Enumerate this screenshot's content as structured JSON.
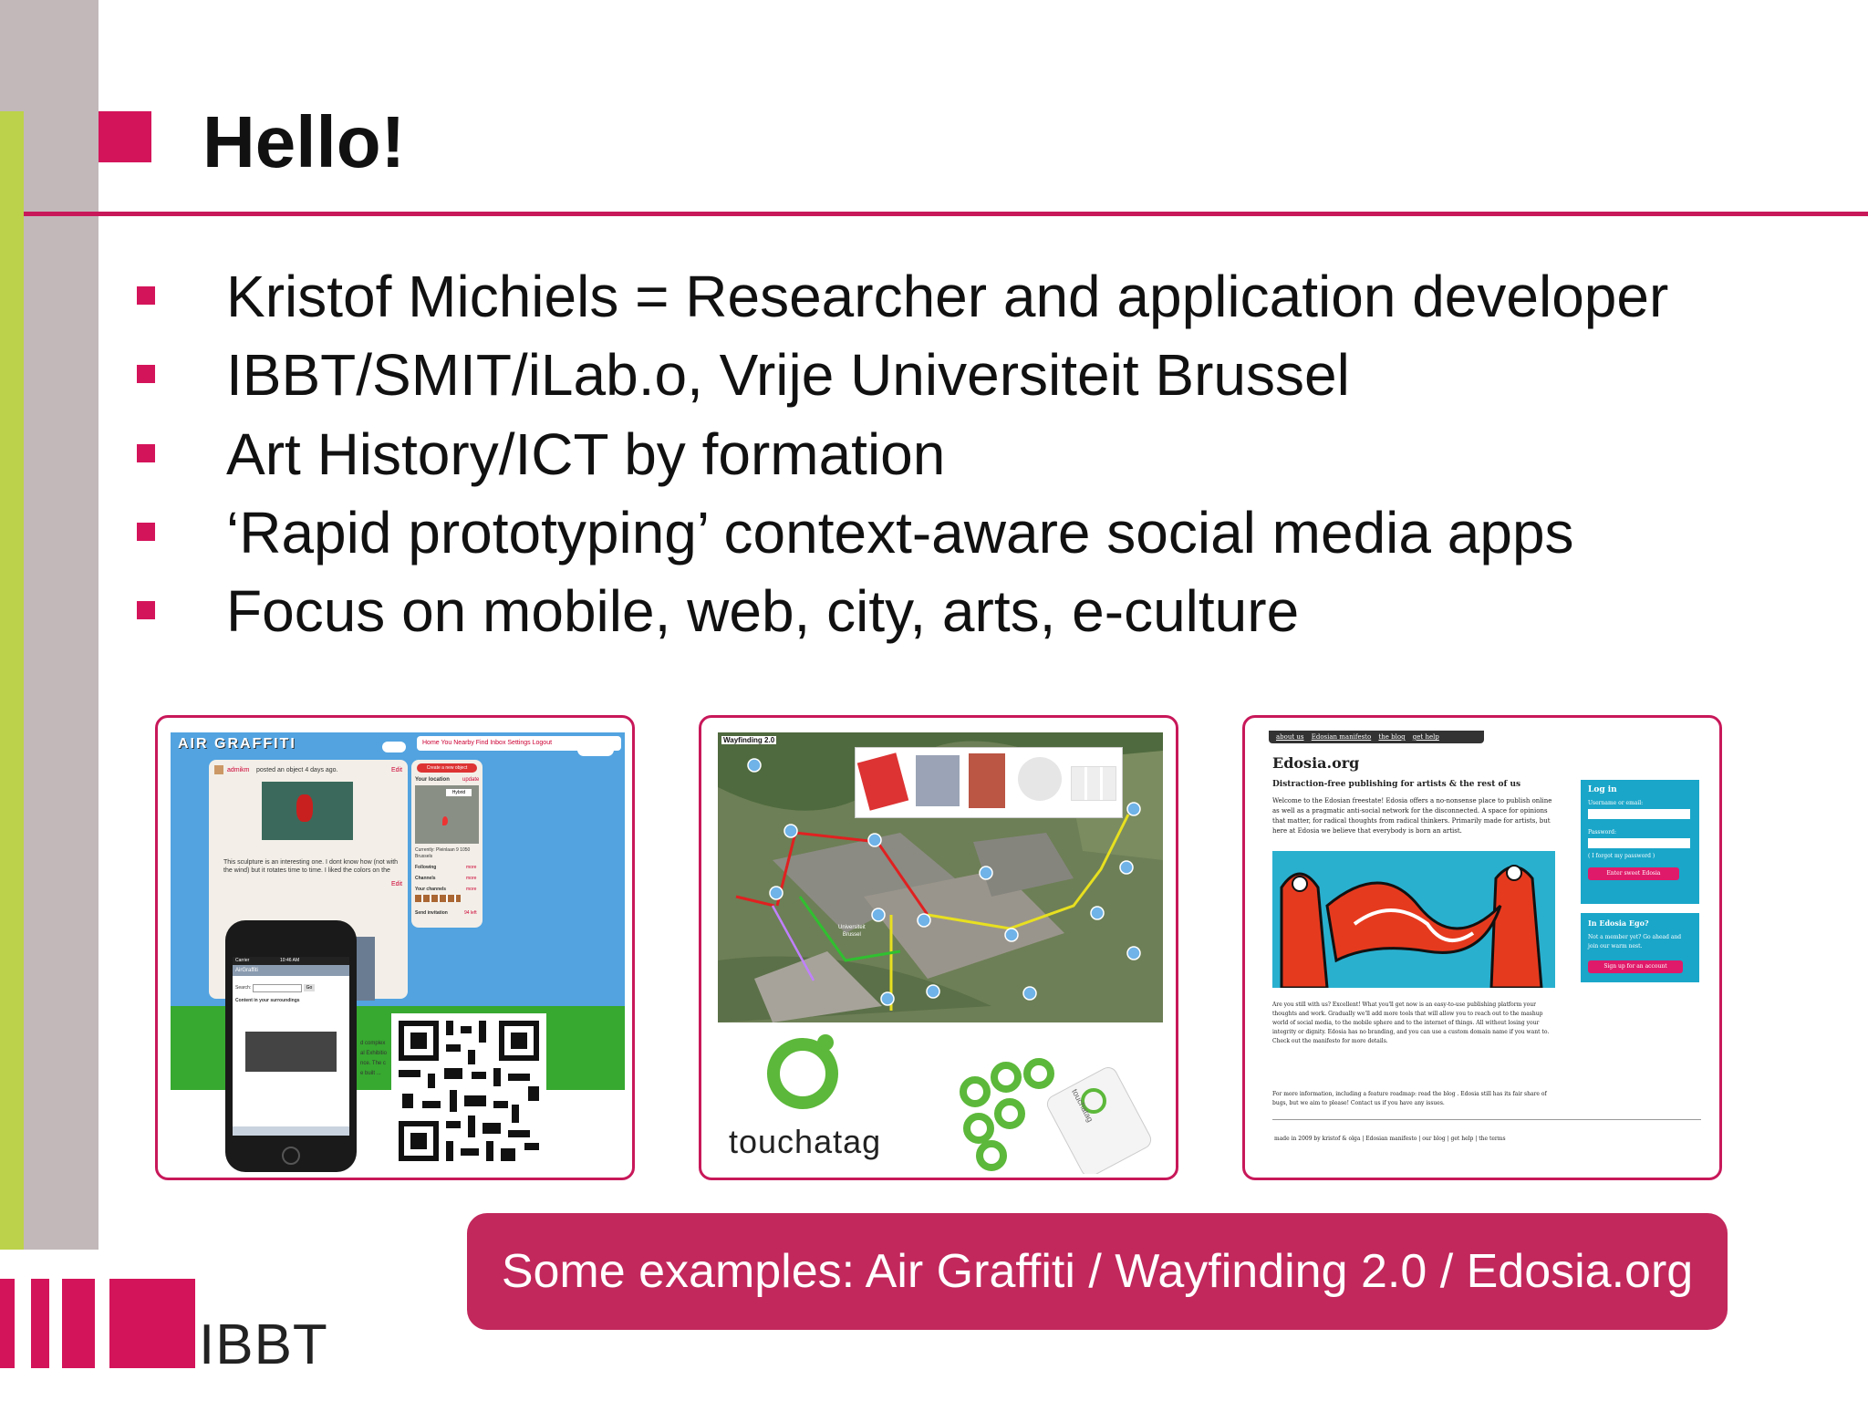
{
  "slide": {
    "title": "Hello!",
    "bullets": [
      "Kristof Michiels = Researcher and application developer",
      "IBBT/SMIT/iLab.o, Vrije Universiteit Brussel",
      "Art History/ICT by formation",
      "‘Rapid prototyping’ context-aware social media apps",
      "Focus on mobile, web, city, arts, e-culture"
    ],
    "caption": "Some examples:  Air Graffiti / Wayfinding 2.0 / Edosia.org",
    "logo_text": "IBBT"
  },
  "airgraffiti": {
    "logo": "AIR GRAFFITI",
    "nav": "Home  You  Nearby  Find  Inbox  Settings  Logout",
    "post_author": "admikm",
    "post_meta": "posted an object 4 days ago.",
    "edit": "Edit",
    "post_text": "This sculpture is an interesting one. I dont know how (not with the wind) but it rotates time to time. I liked the colors on the photo from my trial shots. some problems with the scanning exists but anyway.",
    "create_button": "Create a new object",
    "location_label": "Your location",
    "update": "update",
    "map_type": "Hybrid",
    "current_label": "Currently: Pleinlaan 9 1050 Brussels",
    "sidebar_links": [
      "Following",
      "Channels",
      "Your channels",
      "Send invitation"
    ],
    "sidebar_more": [
      "more",
      "more",
      "more",
      "94 left"
    ],
    "phone_status": "Carrier",
    "phone_time": "10:46 AM",
    "phone_app": "AirGraffiti",
    "phone_search": "Search:",
    "phone_go": "Go",
    "phone_section": "Content in your surroundings",
    "phone_peek": "d complex\nal Exhibitio\nnce. The c\ne built ..."
  },
  "wayfinding": {
    "title": "Wayfinding 2.0",
    "map_label": "Universiteit\nBrussel",
    "brand": "touchatag",
    "device_label": "touchatag",
    "nodes": [
      "1",
      "2",
      "3",
      "4",
      "5",
      "6",
      "7",
      "8",
      "9",
      "10",
      "11",
      "12",
      "13",
      "14",
      "15"
    ]
  },
  "edosia": {
    "nav": [
      "about us",
      "Edosian manifesto",
      "the blog",
      "get help"
    ],
    "site_title": "Edosia.org",
    "subtitle": "Distraction-free publishing for artists & the rest of us",
    "intro": "Welcome to the Edosian freestate! Edosia offers a no-nonsense place to publish online as well as a pragmatic anti-social network for the disconnected. A space for opinions that matter, for radical thoughts from radical thinkers. Primarily made for artists, but here at Edosia we believe that everybody is born an artist.",
    "login_title": "Log in",
    "username_label": "Username or email:",
    "password_label": "Password:",
    "forgot": "( I forgot my password )",
    "enter_button": "Enter sweet Edosia",
    "ego_title": "In Edosia Ego?",
    "ego_text": "Not a member yet? Go ahead and join our warm nest.",
    "signup_button": "Sign up for an account",
    "body1": "Are you still with us? Excellent! What you'll get now is an easy-to-use publishing platform your thoughts and work. Gradually we'll add more tools that will allow you to reach out to the mashup world of social media, to the mobile sphere and to the internet of things. All without losing your integrity or dignity. Edosia has no branding, and you can use a custom domain name if you want to. Check out the manifesto for more details.",
    "body2": "For more information, including a feature roadmap: read the blog . Edosia still has its fair share of bugs, but we aim to please! Contact us if you have any issues.",
    "footer": "made in 2009 by kristof & olga  |  Edosian manifesto  |  our blog  |  get help  |  the terms"
  },
  "colors": {
    "accent": "#d4145a",
    "caption_bg": "#c2285c",
    "grey_bar": "#c2b8ba",
    "green_bar": "#bcd24a",
    "touchatag_green": "#5cb83a",
    "edosia_blue": "#1aa6c9"
  }
}
